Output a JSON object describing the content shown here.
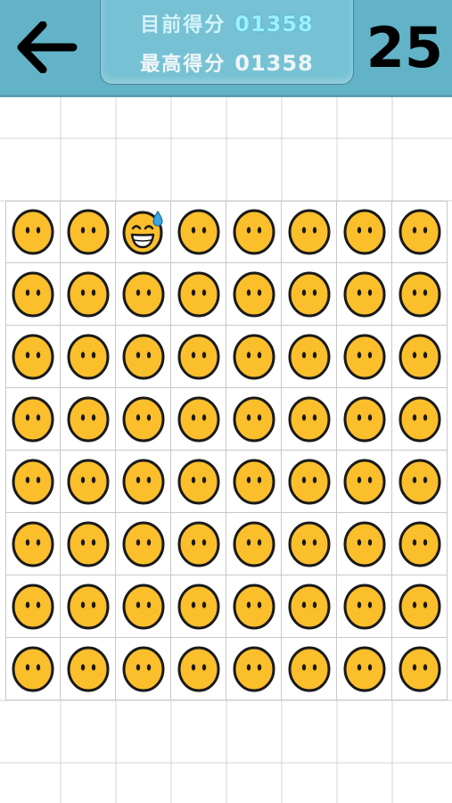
{
  "header": {
    "back_icon": "back-arrow-icon",
    "current_score_label": "目前得分",
    "current_score": "01358",
    "best_score_label": "最高得分",
    "best_score": "01358",
    "moves_left": "25"
  },
  "board": {
    "rows": 8,
    "cols": 8,
    "tiles": [
      [
        "neutral",
        "neutral",
        "sweat-smile",
        "neutral",
        "neutral",
        "neutral",
        "neutral",
        "neutral"
      ],
      [
        "neutral",
        "neutral",
        "neutral",
        "neutral",
        "neutral",
        "neutral",
        "neutral",
        "neutral"
      ],
      [
        "neutral",
        "neutral",
        "neutral",
        "neutral",
        "neutral",
        "neutral",
        "neutral",
        "neutral"
      ],
      [
        "neutral",
        "neutral",
        "neutral",
        "neutral",
        "neutral",
        "neutral",
        "neutral",
        "neutral"
      ],
      [
        "neutral",
        "neutral",
        "neutral",
        "neutral",
        "neutral",
        "neutral",
        "neutral",
        "neutral"
      ],
      [
        "neutral",
        "neutral",
        "neutral",
        "neutral",
        "neutral",
        "neutral",
        "neutral",
        "neutral"
      ],
      [
        "neutral",
        "neutral",
        "neutral",
        "neutral",
        "neutral",
        "neutral",
        "neutral",
        "neutral"
      ],
      [
        "neutral",
        "neutral",
        "neutral",
        "neutral",
        "neutral",
        "neutral",
        "neutral",
        "neutral"
      ]
    ],
    "face_color": "#fbbf2c",
    "outline_color": "#1a1a1a",
    "sweat_color": "#3aa6e8"
  },
  "colors": {
    "header_bg": "#62b3c7",
    "panel_bg": "#76c2d4",
    "grid_line": "#c9c9c9"
  }
}
